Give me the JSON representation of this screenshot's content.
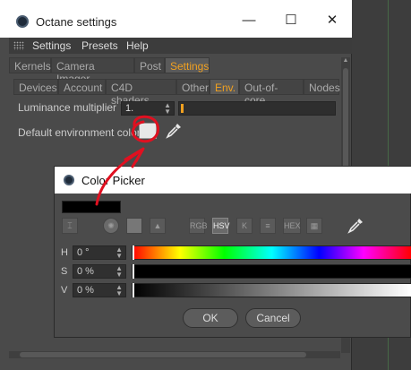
{
  "settings_window": {
    "title": "Octane settings",
    "controls": {
      "minimize": "—",
      "maximize": "☐",
      "close": "✕"
    },
    "menu": [
      "Settings",
      "Presets",
      "Help"
    ],
    "tabs": [
      "Kernels",
      "Camera Imager",
      "Post",
      "Settings"
    ],
    "active_tab": "Settings",
    "subtabs": [
      "Devices",
      "Account",
      "C4D shaders",
      "Other",
      "Env.",
      "Out-of-core",
      "Nodes"
    ],
    "active_subtab": "Env.",
    "luminance_label": "Luminance multiplier",
    "luminance_value": "1.",
    "env_color_label": "Default environment color",
    "env_color": "#e8e8e8"
  },
  "color_picker": {
    "title": "Color Picker",
    "preview_color": "#000000",
    "tools": [
      "RGB",
      "HSV",
      "K",
      "≡",
      "HEX",
      "▦"
    ],
    "selected_tool": "HSV",
    "fields": [
      {
        "label": "H",
        "value": "0 °"
      },
      {
        "label": "S",
        "value": "0 %"
      },
      {
        "label": "V",
        "value": "0 %"
      }
    ],
    "ok_label": "OK",
    "cancel_label": "Cancel"
  },
  "colors": {
    "accent": "#f0a020",
    "annotation_red": "#e01020"
  }
}
